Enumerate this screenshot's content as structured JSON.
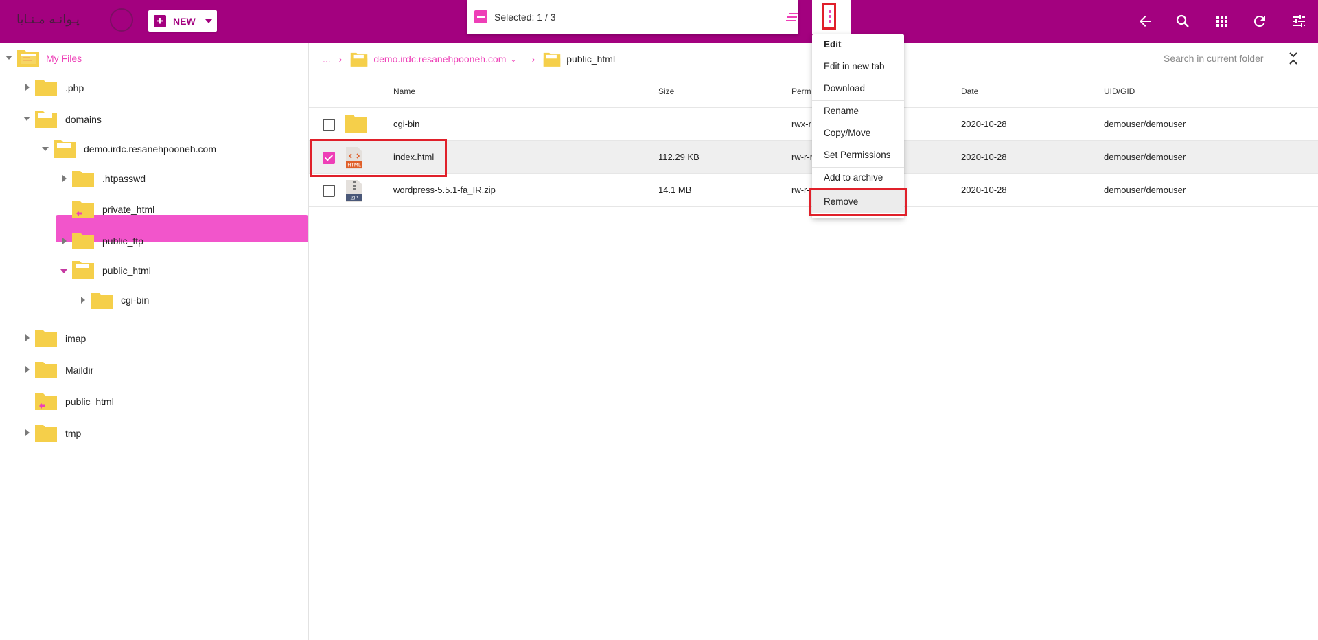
{
  "header": {
    "logo_text": "پـوانـه مـنـایا",
    "new_button_label": "NEW",
    "selection_text": "Selected: 1 / 3",
    "icons": [
      "arrow-left-icon",
      "search-icon",
      "grid-view-icon",
      "refresh-icon",
      "settings-sliders-icon"
    ]
  },
  "tree": {
    "root": "My Files",
    "items": [
      {
        "label": ".php"
      },
      {
        "label": "domains"
      },
      {
        "label": "demo.irdc.resanehpooneh.com"
      },
      {
        "label": ".htpasswd"
      },
      {
        "label": "private_html"
      },
      {
        "label": "public_ftp"
      },
      {
        "label": "public_html"
      },
      {
        "label": "cgi-bin"
      },
      {
        "label": "imap"
      },
      {
        "label": "Maildir"
      },
      {
        "label": "public_html"
      },
      {
        "label": "tmp"
      }
    ]
  },
  "breadcrumb": {
    "ellipsis": "...",
    "domain": "demo.irdc.resanehpooneh.com",
    "current": "public_html"
  },
  "search": {
    "placeholder": "Search in current folder"
  },
  "table": {
    "headers": {
      "name": "Name",
      "size": "Size",
      "perm": "Perm",
      "date": "Date",
      "uid": "UID/GID"
    },
    "rows": [
      {
        "name": "cgi-bin",
        "size": "",
        "perm": "rwx-r",
        "date": "2020-10-28",
        "uid": "demouser/demouser",
        "type": "folder",
        "selected": false
      },
      {
        "name": "index.html",
        "size": "112.29 KB",
        "perm": "rw-r-r",
        "date": "2020-10-28",
        "uid": "demouser/demouser",
        "type": "html",
        "selected": true
      },
      {
        "name": "wordpress-5.5.1-fa_IR.zip",
        "size": "14.1 MB",
        "perm": "rw-r-",
        "date": "2020-10-28",
        "uid": "demouser/demouser",
        "type": "zip",
        "selected": false
      }
    ],
    "html_badge": "HTML",
    "zip_badge": "ZIP"
  },
  "context_menu": {
    "edit": "Edit",
    "edit_new_tab": "Edit in new tab",
    "download": "Download",
    "rename": "Rename",
    "copy_move": "Copy/Move",
    "set_permissions": "Set Permissions",
    "add_archive": "Add to archive",
    "remove": "Remove"
  },
  "colors": {
    "brand": "#a3017f",
    "accent": "#ee3fb7",
    "selected_tree": "#f255cb",
    "highlight": "#e0202a",
    "folder": "#f5cf4a"
  }
}
